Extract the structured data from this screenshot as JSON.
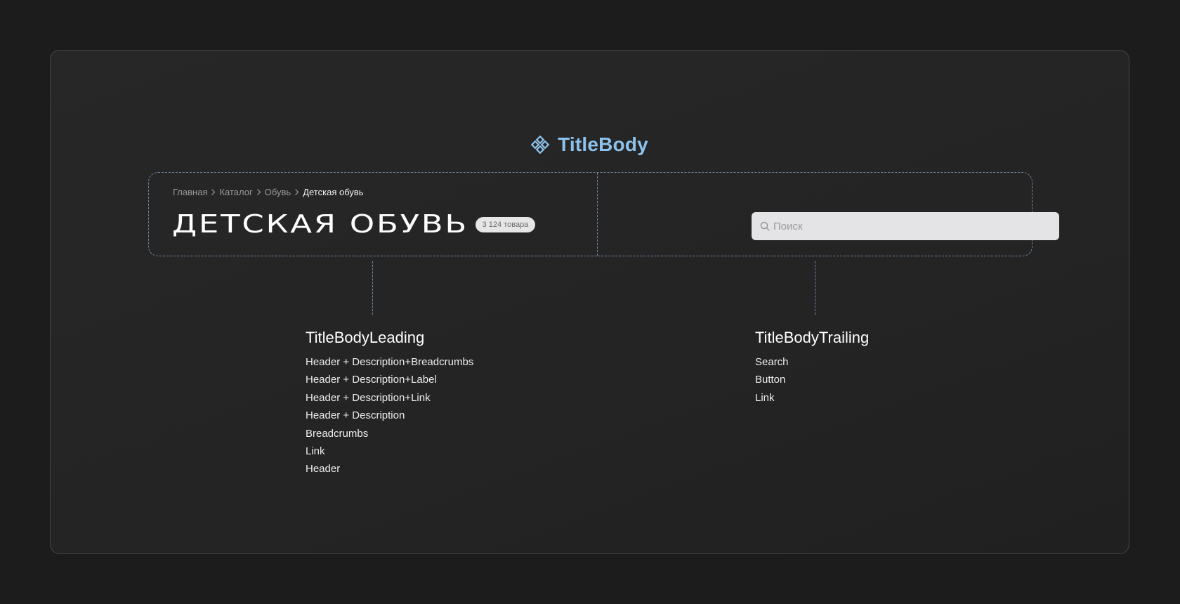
{
  "title": "TitleBody",
  "breadcrumbs": {
    "items": [
      "Главная",
      "Каталог",
      "Обувь"
    ],
    "current": "Детская обувь"
  },
  "heading": "ДЕТСКАЯ ОБУВЬ",
  "badge": "3 124 товара",
  "search": {
    "placeholder": "Поиск",
    "value": ""
  },
  "leading": {
    "title": "TitleBodyLeading",
    "items": [
      "Header + Description+Breadcrumbs",
      "Header + Description+Label",
      "Header + Description+Link",
      "Header + Description",
      "Breadcrumbs",
      "Link",
      "Header"
    ]
  },
  "trailing": {
    "title": "TitleBodyTrailing",
    "items": [
      "Search",
      "Button",
      "Link"
    ]
  },
  "colors": {
    "accent": "#8cc2ec",
    "background": "#1c1c1c",
    "card": "#262626",
    "dashed_outline": "#6f89a6"
  },
  "icons": {
    "title": "diamond-grid-icon",
    "breadcrumb_separator": "chevron-right-icon",
    "search": "search-icon"
  }
}
